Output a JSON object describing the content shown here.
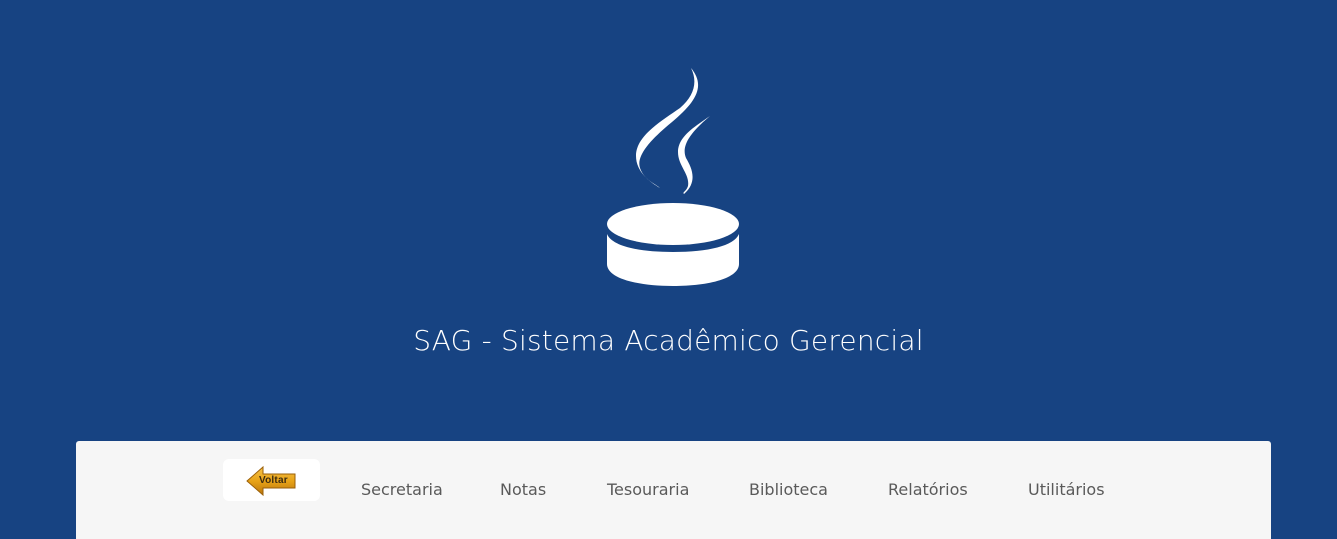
{
  "header": {
    "title": "SAG - Sistema Acadêmico Gerencial",
    "logo_icon": "steaming-cup-icon"
  },
  "nav": {
    "back_label": "Voltar",
    "back_icon": "left-arrow-icon",
    "items": [
      {
        "label": "Secretaria"
      },
      {
        "label": "Notas"
      },
      {
        "label": "Tesouraria"
      },
      {
        "label": "Biblioteca"
      },
      {
        "label": "Relatórios"
      },
      {
        "label": "Utilitários"
      }
    ]
  },
  "colors": {
    "background": "#174382",
    "panel": "#f6f6f6",
    "nav_text": "#5a5a5a",
    "arrow": "#e8a317"
  }
}
